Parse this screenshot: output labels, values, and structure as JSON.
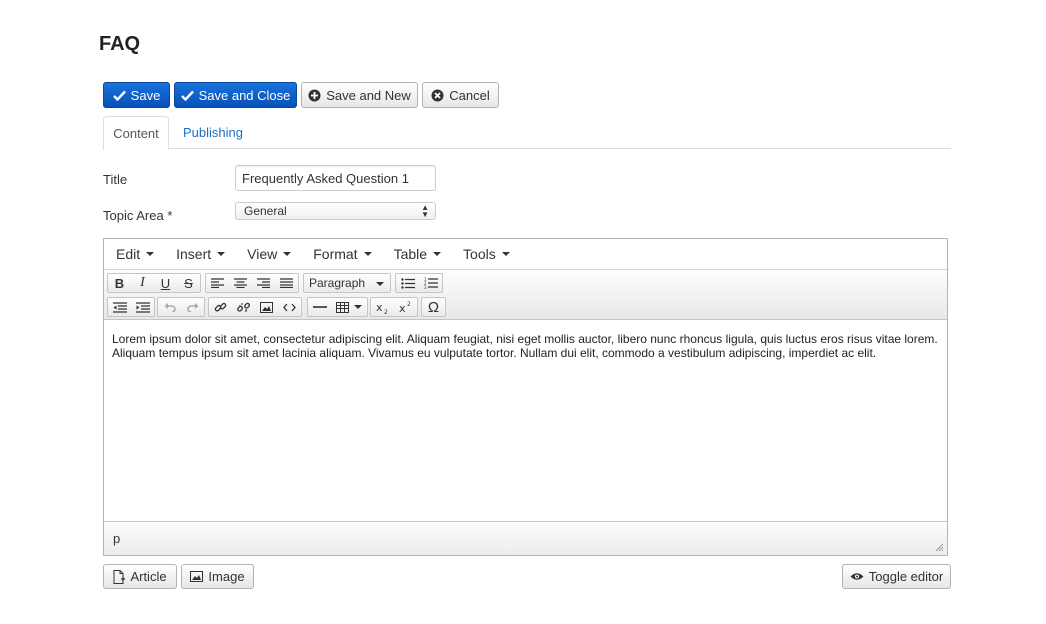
{
  "page": {
    "title": "FAQ"
  },
  "toolbar": {
    "save": "Save",
    "save_close": "Save and Close",
    "save_new": "Save and New",
    "cancel": "Cancel"
  },
  "tabs": [
    {
      "label": "Content",
      "active": true
    },
    {
      "label": "Publishing",
      "active": false
    }
  ],
  "form": {
    "title_label": "Title",
    "title_value": "Frequently Asked Question 1",
    "topic_label": "Topic Area *",
    "topic_value": "General"
  },
  "editor": {
    "menus": [
      "Edit",
      "Insert",
      "View",
      "Format",
      "Table",
      "Tools"
    ],
    "format_select": "Paragraph",
    "content": "Lorem ipsum dolor sit amet, consectetur adipiscing elit. Aliquam feugiat, nisi eget mollis auctor, libero nunc rhoncus ligula, quis luctus eros risus vitae lorem. Aliquam tempus ipsum sit amet lacinia aliquam. Vivamus eu vulputate tortor. Nullam dui elit, commodo a vestibulum adipiscing, imperdiet ac elit.",
    "path": "p"
  },
  "bottom": {
    "article": "Article",
    "image": "Image",
    "toggle": "Toggle editor"
  },
  "colors": {
    "primary": "#0a5fc8",
    "link": "#1f6fc5"
  }
}
